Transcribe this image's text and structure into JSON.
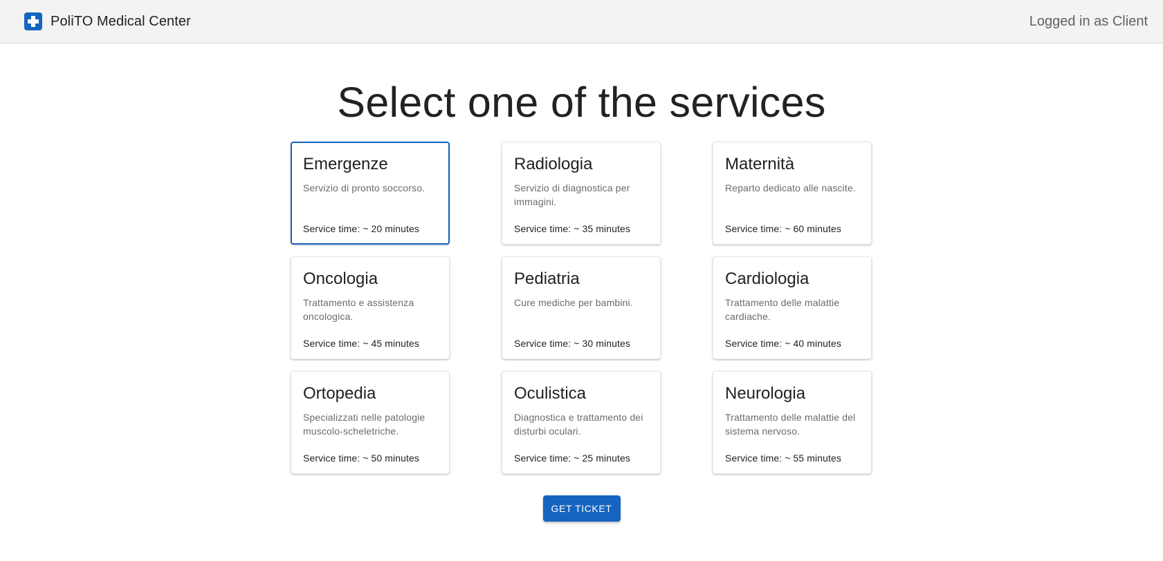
{
  "header": {
    "brand_icon": "medical-cross-icon",
    "brand_name": "PoliTO Medical Center",
    "login_status": "Logged in as Client",
    "accent_color": "#1565c0"
  },
  "main": {
    "title": "Select one of the services",
    "selected_service": "Emergenze",
    "services": [
      {
        "name": "Emergenze",
        "description": "Servizio di pronto soccorso.",
        "service_time": "Service time: ~ 20 minutes"
      },
      {
        "name": "Radiologia",
        "description": "Servizio di diagnostica per immagini.",
        "service_time": "Service time: ~ 35 minutes"
      },
      {
        "name": "Maternità",
        "description": "Reparto dedicato alle nascite.",
        "service_time": "Service time: ~ 60 minutes"
      },
      {
        "name": "Oncologia",
        "description": "Trattamento e assistenza oncologica.",
        "service_time": "Service time: ~ 45 minutes"
      },
      {
        "name": "Pediatria",
        "description": "Cure mediche per bambini.",
        "service_time": "Service time: ~ 30 minutes"
      },
      {
        "name": "Cardiologia",
        "description": "Trattamento delle malattie cardiache.",
        "service_time": "Service time: ~ 40 minutes"
      },
      {
        "name": "Ortopedia",
        "description": "Specializzati nelle patologie muscolo-scheletriche.",
        "service_time": "Service time: ~ 50 minutes"
      },
      {
        "name": "Oculistica",
        "description": "Diagnostica e trattamento dei disturbi oculari.",
        "service_time": "Service time: ~ 25 minutes"
      },
      {
        "name": "Neurologia",
        "description": "Trattamento delle malattie del sistema nervoso.",
        "service_time": "Service time: ~ 55 minutes"
      }
    ],
    "ticket_button_label": "GET TICKET"
  }
}
